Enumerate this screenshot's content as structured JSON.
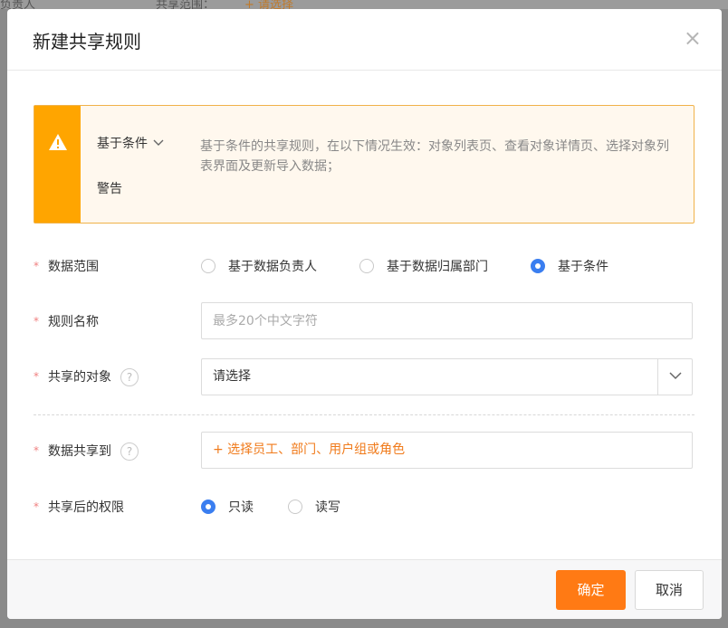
{
  "background": {
    "left_text": "负责人",
    "middle_text": "共享范围：",
    "right_text": "+ 请选择"
  },
  "modal": {
    "title": "新建共享规则",
    "close_glyph": "×"
  },
  "alert": {
    "type_label": "基于条件",
    "sub_label": "警告",
    "message": "基于条件的共享规则，在以下情况生效：对象列表页、查看对象详情页、选择对象列表界面及更新导入数据；",
    "accent_color": "#ffa500"
  },
  "form": {
    "required_mark": "*",
    "data_scope": {
      "label": "数据范围",
      "options": [
        {
          "label": "基于数据负责人",
          "selected": false
        },
        {
          "label": "基于数据归属部门",
          "selected": false
        },
        {
          "label": "基于条件",
          "selected": true
        }
      ]
    },
    "rule_name": {
      "label": "规则名称",
      "value": "",
      "placeholder": "最多20个中文字符"
    },
    "share_object": {
      "label": "共享的对象",
      "help_glyph": "?",
      "selected": "请选择"
    },
    "share_to": {
      "label": "数据共享到",
      "help_glyph": "?",
      "picker_text": "+ 选择员工、部门、用户组或角色"
    },
    "permission": {
      "label": "共享后的权限",
      "options": [
        {
          "label": "只读",
          "selected": true
        },
        {
          "label": "读写",
          "selected": false
        }
      ]
    }
  },
  "footer": {
    "confirm_label": "确定",
    "cancel_label": "取消"
  },
  "colors": {
    "primary": "#ff7a14",
    "radio_selected": "#3a7ef0",
    "link_orange": "#f07a1a"
  }
}
